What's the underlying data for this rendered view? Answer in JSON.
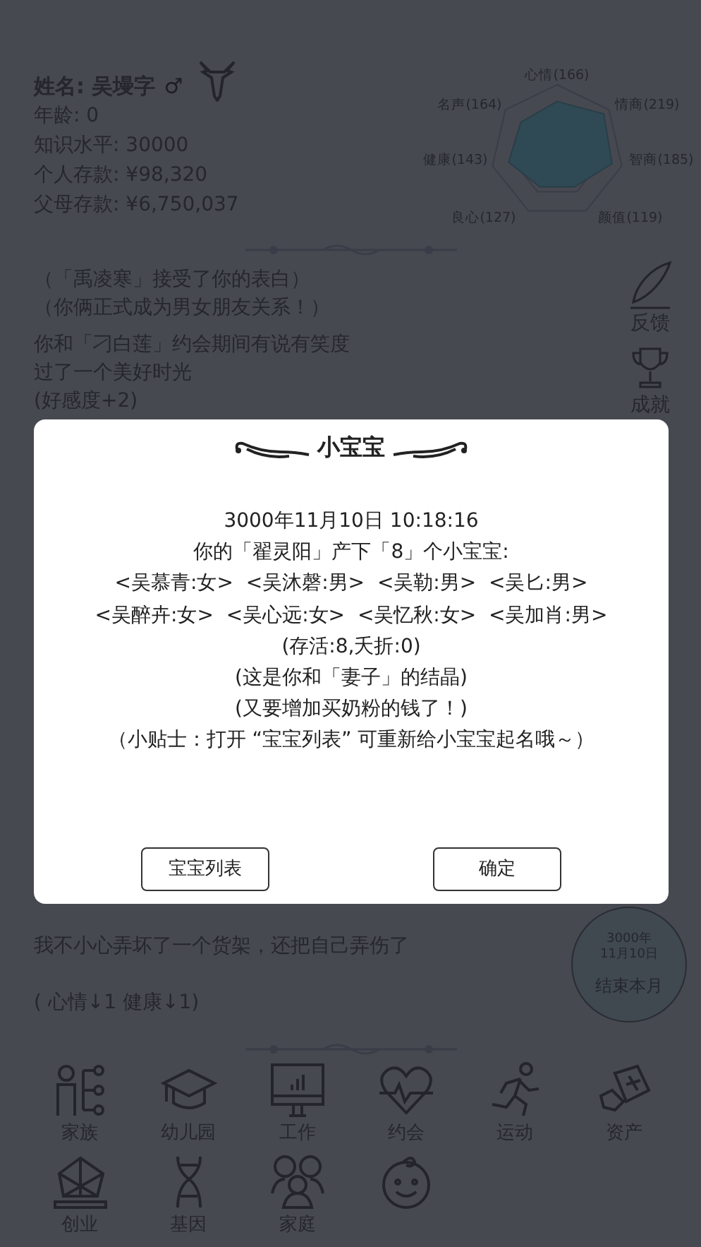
{
  "profile": {
    "name": "姓名: 吴墁字",
    "gender_symbol": "♂",
    "lines": [
      "年龄: 0",
      "知识水平: 30000",
      "个人存款: ¥98,320",
      "父母存款: ¥6,750,037"
    ]
  },
  "stats": [
    "心情(166)",
    "名声(164)",
    "情商(219)",
    "健康(143)",
    "智商(185)",
    "良心(127)",
    "颜值(119)"
  ],
  "log_top": [
    "（「禹凌寒」接受了你的表白）",
    "（你俩正式成为男女朋友关系！）",
    "你和「刁白莲」约会期间有说有笑度过了一个美好时光",
    "(好感度+2)"
  ],
  "side_buttons": [
    {
      "label": "反馈",
      "kind": "quill"
    },
    {
      "label": "成就",
      "kind": "trophy"
    }
  ],
  "log_bottom": [
    "我不小心弄坏了一个货架，还把自己弄伤了",
    "( 心情↓1 健康↓1)"
  ],
  "end_month": {
    "date_lines": [
      "3000年",
      "11月10日"
    ],
    "label": "结束本月"
  },
  "actions": [
    {
      "label": "家族",
      "kind": "tree"
    },
    {
      "label": "幼儿园",
      "kind": "cap"
    },
    {
      "label": "工作",
      "kind": "monitor"
    },
    {
      "label": "约会",
      "kind": "heart"
    },
    {
      "label": "运动",
      "kind": "runner"
    },
    {
      "label": "资产",
      "kind": "asset"
    },
    {
      "label": "创业",
      "kind": "network"
    },
    {
      "label": "基因",
      "kind": "dna"
    },
    {
      "label": "家庭",
      "kind": "people"
    },
    {
      "kind": "baby"
    }
  ],
  "dialog": {
    "title": "小宝宝",
    "lines": [
      "3000年11月10日 10:18:16",
      "你的「翟灵阳」产下「8」个小宝宝:",
      "<吴慕青:女>  <吴沐磬:男>  <吴勒:男>  <吴匕:男>",
      "<吴醉卉:女>  <吴心远:女>  <吴忆秋:女>  <吴加肖:男>",
      "(存活:8,夭折:0)",
      "(这是你和「妻子」的结晶)",
      "(又要增加买奶粉的钱了！)",
      "（小贴士：打开 “宝宝列表” 可重新给小宝宝起名哦～）"
    ],
    "buttons": [
      "宝宝列表",
      "确定"
    ]
  }
}
